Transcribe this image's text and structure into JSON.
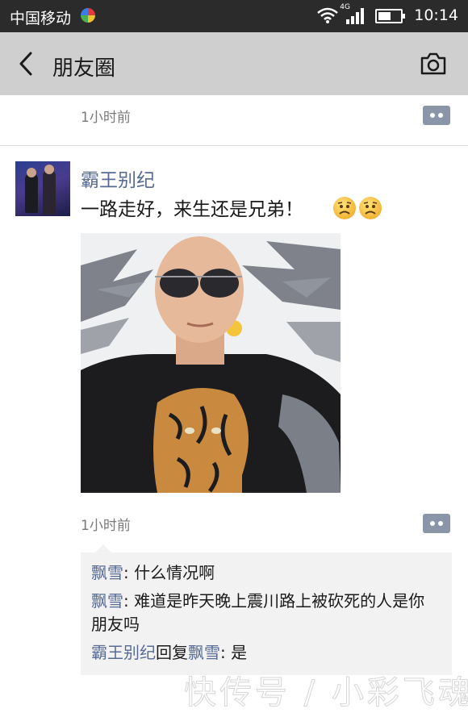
{
  "status_bar": {
    "carrier": "中国移动",
    "network": "4G",
    "time": "10:14"
  },
  "nav": {
    "title": "朋友圈",
    "icons": {
      "back": "back-chevron-icon",
      "camera": "camera-icon"
    }
  },
  "prev_post": {
    "time": "1小时前"
  },
  "post": {
    "author": "霸王别纪",
    "text": "一路走好，来生还是兄弟！",
    "emoji": "sad-face-emoji",
    "time": "1小时前"
  },
  "comments": [
    {
      "name": "飘雪",
      "sep": ": ",
      "text": "什么情况啊"
    },
    {
      "name": "飘雪",
      "sep": ": ",
      "text": "难道是昨天晚上震川路上被砍死的人是你朋友吗"
    },
    {
      "name": "霸王别纪",
      "reply_word": "回复",
      "reply_to": "飘雪",
      "sep": ": ",
      "text": "是"
    }
  ],
  "watermark": "快传号 / 小彩飞魂",
  "colors": {
    "link_blue": "#576b95",
    "nav_bg": "#cfcfcf",
    "status_bg": "#2b2b2b"
  }
}
